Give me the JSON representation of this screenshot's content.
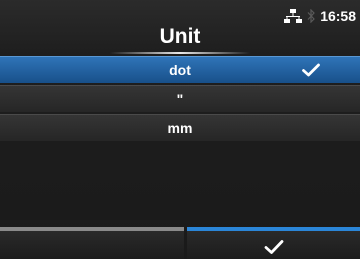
{
  "header": {
    "title": "Unit",
    "status": {
      "time": "16:58",
      "icons": [
        "network-icon",
        "bluetooth-icon"
      ]
    }
  },
  "options": [
    {
      "label": "dot",
      "selected": true,
      "checked": true
    },
    {
      "label": "\"",
      "selected": false,
      "checked": false
    },
    {
      "label": "mm",
      "selected": false,
      "checked": false
    }
  ],
  "softkeys": {
    "left": {
      "label": "",
      "accent": "#8a8a8a"
    },
    "right": {
      "icon": "check-icon",
      "accent": "#2b86d8"
    }
  },
  "colors": {
    "selected_row": "#1f5e9e",
    "background": "#1e1e1e"
  }
}
